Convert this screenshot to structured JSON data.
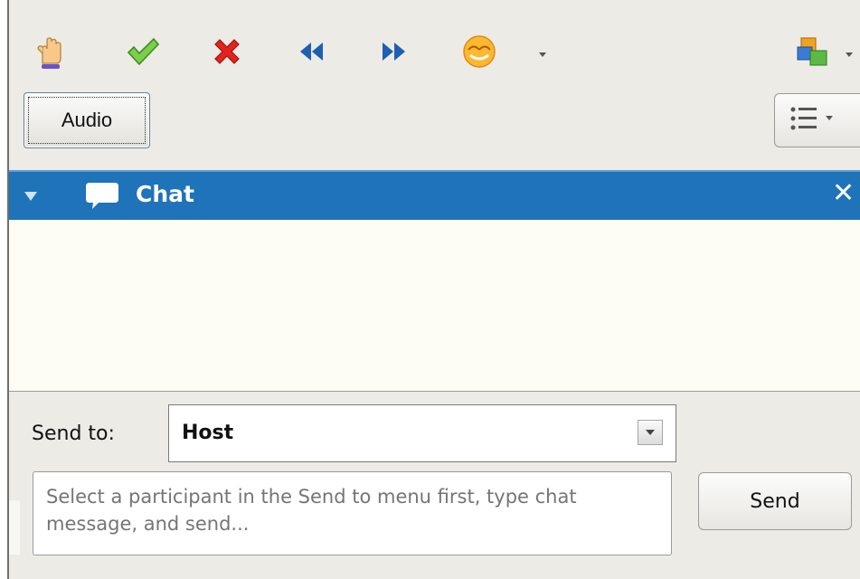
{
  "toolbar": {
    "icons": [
      "raise-hand-icon",
      "checkmark-icon",
      "cross-icon",
      "rewind-icon",
      "fast-forward-icon",
      "emoticon-icon",
      "share-application-icon"
    ],
    "audio_label": "Audio",
    "list_menu_icon": "list-icon"
  },
  "chat_panel": {
    "title": "Chat",
    "collapse_icon": "triangle-down-icon",
    "bubble_icon": "speech-bubble-icon",
    "close_label": "✕"
  },
  "send": {
    "label": "Send to:",
    "selected": "Host",
    "message_placeholder": "Select a participant in the Send to menu first, type chat message, and send...",
    "button_label": "Send"
  },
  "colors": {
    "header_blue": "#1f73b8",
    "chat_bg": "#fdfdf3",
    "panel_bg": "#ecebe6"
  }
}
